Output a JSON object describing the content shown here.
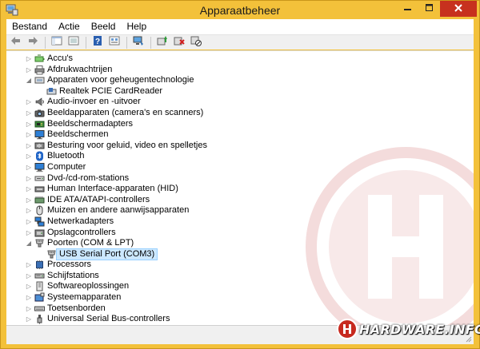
{
  "window": {
    "title": "Apparaatbeheer",
    "icons": {
      "app": "device-manager-icon",
      "minimize": "minimize-icon",
      "maximize": "maximize-icon",
      "close": "close-icon"
    }
  },
  "menu": [
    "Bestand",
    "Actie",
    "Beeld",
    "Help"
  ],
  "toolbar": [
    "back-arrow-icon",
    "forward-arrow-icon",
    "show-hide-console-tree-icon",
    "properties-list-icon",
    "help-icon",
    "device-properties-icon",
    "monitor-icon",
    "scan-hardware-icon",
    "update-driver-icon",
    "uninstall-icon",
    "disable-icon"
  ],
  "tree": [
    {
      "label": "Accu's",
      "level": 1,
      "expander": "collapsed",
      "icon": "battery-icon"
    },
    {
      "label": "Afdrukwachtrijen",
      "level": 1,
      "expander": "collapsed",
      "icon": "printer-icon"
    },
    {
      "label": "Apparaten voor geheugentechnologie",
      "level": 1,
      "expander": "expanded",
      "icon": "memory-device-icon"
    },
    {
      "label": "Realtek PCIE CardReader",
      "level": 2,
      "expander": "none",
      "icon": "card-reader-icon"
    },
    {
      "label": "Audio-invoer en -uitvoer",
      "level": 1,
      "expander": "collapsed",
      "icon": "speaker-icon"
    },
    {
      "label": "Beeldapparaten (camera's en scanners)",
      "level": 1,
      "expander": "collapsed",
      "icon": "camera-icon"
    },
    {
      "label": "Beeldschermadapters",
      "level": 1,
      "expander": "collapsed",
      "icon": "display-adapter-icon"
    },
    {
      "label": "Beeldschermen",
      "level": 1,
      "expander": "collapsed",
      "icon": "monitor-icon"
    },
    {
      "label": "Besturing voor geluid, video en spelletjes",
      "level": 1,
      "expander": "collapsed",
      "icon": "sound-video-icon"
    },
    {
      "label": "Bluetooth",
      "level": 1,
      "expander": "collapsed",
      "icon": "bluetooth-icon"
    },
    {
      "label": "Computer",
      "level": 1,
      "expander": "collapsed",
      "icon": "computer-icon"
    },
    {
      "label": "Dvd-/cd-rom-stations",
      "level": 1,
      "expander": "collapsed",
      "icon": "optical-drive-icon"
    },
    {
      "label": "Human Interface-apparaten (HID)",
      "level": 1,
      "expander": "collapsed",
      "icon": "hid-icon"
    },
    {
      "label": "IDE ATA/ATAPI-controllers",
      "level": 1,
      "expander": "collapsed",
      "icon": "ide-controller-icon"
    },
    {
      "label": "Muizen en andere aanwijsapparaten",
      "level": 1,
      "expander": "collapsed",
      "icon": "mouse-icon"
    },
    {
      "label": "Netwerkadapters",
      "level": 1,
      "expander": "collapsed",
      "icon": "network-adapter-icon"
    },
    {
      "label": "Opslagcontrollers",
      "level": 1,
      "expander": "collapsed",
      "icon": "storage-controller-icon"
    },
    {
      "label": "Poorten (COM & LPT)",
      "level": 1,
      "expander": "expanded",
      "icon": "port-icon"
    },
    {
      "label": "USB Serial Port (COM3)",
      "level": 2,
      "expander": "none",
      "icon": "port-icon",
      "selected": true
    },
    {
      "label": "Processors",
      "level": 1,
      "expander": "collapsed",
      "icon": "processor-icon"
    },
    {
      "label": "Schijfstations",
      "level": 1,
      "expander": "collapsed",
      "icon": "disk-drive-icon"
    },
    {
      "label": "Softwareoplossingen",
      "level": 1,
      "expander": "collapsed",
      "icon": "software-component-icon"
    },
    {
      "label": "Systeemapparaten",
      "level": 1,
      "expander": "collapsed",
      "icon": "system-device-icon"
    },
    {
      "label": "Toetsenborden",
      "level": 1,
      "expander": "collapsed",
      "icon": "keyboard-icon"
    },
    {
      "label": "Universal Serial Bus-controllers",
      "level": 1,
      "expander": "collapsed",
      "icon": "usb-icon"
    }
  ],
  "watermark": {
    "brand": "HARDWARE.INFO",
    "icon": "hardware-info-logo-icon"
  },
  "colors": {
    "frame": "#f3c13a",
    "close": "#c7311e",
    "selection": "#cce8ff",
    "brand": "#c7291e"
  }
}
